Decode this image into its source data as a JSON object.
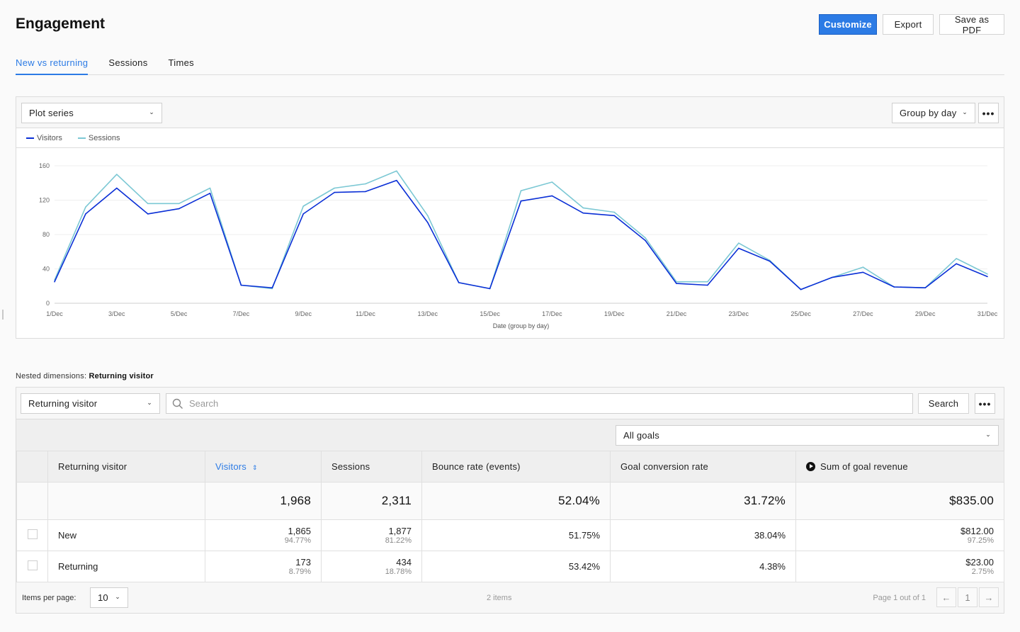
{
  "header": {
    "title": "Engagement",
    "actions": {
      "customize": "Customize",
      "export": "Export",
      "save_pdf": "Save as PDF"
    }
  },
  "tabs": [
    {
      "label": "New vs returning",
      "active": true
    },
    {
      "label": "Sessions",
      "active": false
    },
    {
      "label": "Times",
      "active": false
    }
  ],
  "chart_panel": {
    "plot_series_label": "Plot series",
    "group_by_label": "Group by day",
    "more_icon": "more-dots-icon"
  },
  "chart_data": {
    "type": "line",
    "title": "",
    "xlabel": "Date (group by day)",
    "ylabel": "",
    "ylim": [
      0,
      160
    ],
    "yticks": [
      0,
      40,
      80,
      120,
      160
    ],
    "grid": true,
    "legend_position": "top-left",
    "x": [
      "1/Dec",
      "2/Dec",
      "3/Dec",
      "4/Dec",
      "5/Dec",
      "6/Dec",
      "7/Dec",
      "8/Dec",
      "9/Dec",
      "10/Dec",
      "11/Dec",
      "12/Dec",
      "13/Dec",
      "14/Dec",
      "15/Dec",
      "16/Dec",
      "17/Dec",
      "18/Dec",
      "19/Dec",
      "20/Dec",
      "21/Dec",
      "22/Dec",
      "23/Dec",
      "24/Dec",
      "25/Dec",
      "26/Dec",
      "27/Dec",
      "28/Dec",
      "29/Dec",
      "30/Dec",
      "31/Dec"
    ],
    "xtick_labels": [
      "1/Dec",
      "3/Dec",
      "5/Dec",
      "7/Dec",
      "9/Dec",
      "11/Dec",
      "13/Dec",
      "15/Dec",
      "17/Dec",
      "19/Dec",
      "21/Dec",
      "23/Dec",
      "25/Dec",
      "27/Dec",
      "29/Dec",
      "31/Dec"
    ],
    "series": [
      {
        "name": "Visitors",
        "color": "#0a2fd6",
        "values": [
          25,
          104,
          134,
          104,
          110,
          128,
          21,
          18,
          104,
          129,
          130,
          143,
          94,
          24,
          17,
          119,
          125,
          105,
          102,
          73,
          23,
          21,
          64,
          49,
          16,
          30,
          36,
          19,
          18,
          46,
          31
        ]
      },
      {
        "name": "Sessions",
        "color": "#7cc8d4",
        "values": [
          27,
          112,
          150,
          116,
          116,
          134,
          21,
          17,
          113,
          134,
          139,
          154,
          102,
          24,
          17,
          131,
          141,
          111,
          106,
          76,
          25,
          25,
          70,
          50,
          16,
          30,
          42,
          19,
          18,
          52,
          34
        ]
      }
    ]
  },
  "nested": {
    "prefix": "Nested dimensions:",
    "value": "Returning visitor"
  },
  "table_toolbar": {
    "dimension_select": "Returning visitor",
    "search_placeholder": "Search",
    "search_button": "Search",
    "goals_select": "All goals"
  },
  "table": {
    "columns": [
      "Returning visitor",
      "Visitors",
      "Sessions",
      "Bounce rate (events)",
      "Goal conversion rate",
      "Sum of goal revenue"
    ],
    "sorted_column": "Visitors",
    "totals": {
      "visitors": "1,968",
      "sessions": "2,311",
      "bounce": "52.04%",
      "conversion": "31.72%",
      "revenue": "$835.00"
    },
    "rows": [
      {
        "label": "New",
        "visitors": "1,865",
        "visitors_pct": "94.77%",
        "sessions": "1,877",
        "sessions_pct": "81.22%",
        "bounce": "51.75%",
        "conversion": "38.04%",
        "revenue": "$812.00",
        "revenue_pct": "97.25%"
      },
      {
        "label": "Returning",
        "visitors": "173",
        "visitors_pct": "8.79%",
        "sessions": "434",
        "sessions_pct": "18.78%",
        "bounce": "53.42%",
        "conversion": "4.38%",
        "revenue": "$23.00",
        "revenue_pct": "2.75%"
      }
    ]
  },
  "footer": {
    "items_per_page_label": "Items per page:",
    "items_per_page": "10",
    "items_count": "2 items",
    "page_info": "Page 1 out of 1",
    "current_page": "1"
  },
  "colors": {
    "accent": "#2c7be5",
    "visitors": "#0a2fd6",
    "sessions": "#7cc8d4"
  }
}
